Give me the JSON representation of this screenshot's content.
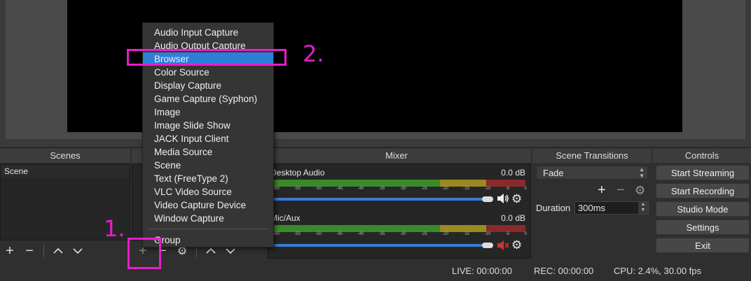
{
  "docks": {
    "scenes": "Scenes",
    "mixer": "Mixer",
    "transitions": "Scene Transitions",
    "controls": "Controls"
  },
  "scenes": {
    "items": [
      "Scene"
    ]
  },
  "mixer": {
    "channels": [
      {
        "name": "Desktop Audio",
        "level": "0.0 dB",
        "muted": false
      },
      {
        "name": "Mic/Aux",
        "level": "0.0 dB",
        "muted": true
      }
    ],
    "ticks": [
      "-60",
      "-55",
      "-50",
      "-45",
      "-40",
      "-35",
      "-30",
      "-25",
      "-20",
      "-15",
      "-10",
      "-5",
      "0"
    ]
  },
  "transitions": {
    "selected": "Fade",
    "duration_label": "Duration",
    "duration_value": "300ms"
  },
  "controls": {
    "buttons": [
      "Start Streaming",
      "Start Recording",
      "Studio Mode",
      "Settings",
      "Exit"
    ]
  },
  "status": {
    "live": "LIVE: 00:00:00",
    "rec": "REC: 00:00:00",
    "cpu": "CPU: 2.4%, 30.00 fps"
  },
  "menu": {
    "items": [
      "Audio Input Capture",
      "Audio Output Capture",
      "Browser",
      "Color Source",
      "Display Capture",
      "Game Capture (Syphon)",
      "Image",
      "Image Slide Show",
      "JACK Input Client",
      "Media Source",
      "Scene",
      "Text (FreeType 2)",
      "VLC Video Source",
      "Video Capture Device",
      "Window Capture"
    ],
    "group": "Group",
    "selected_index": 2
  },
  "annotations": {
    "one": "1.",
    "two": "2."
  },
  "colors": {
    "highlight": "#2f7fd8",
    "annotation": "#e61ec8",
    "meter_green": "#3a8a2a",
    "meter_yellow": "#9a8a20",
    "meter_red": "#8a2a2a"
  }
}
